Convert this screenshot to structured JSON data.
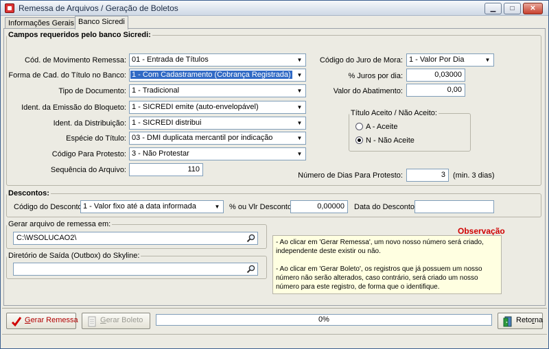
{
  "window": {
    "title": "Remessa de Arquivos / Geração de Boletos",
    "minimize_glyph": "▁",
    "maximize_glyph": "□",
    "close_glyph": "✕"
  },
  "tabs": [
    {
      "label": "Informações Gerais"
    },
    {
      "label": "Banco Sicredi"
    }
  ],
  "sicredi": {
    "legend": "Campos requeridos pelo banco Sicredi:",
    "cod_mov": {
      "label": "Cód. de Movimento Remessa:",
      "value": "01 - Entrada de Títulos"
    },
    "forma_cad": {
      "label": "Forma de Cad. do Título no Banco:",
      "value": "1 - Com Cadastramento (Cobrança Registrada)"
    },
    "tipo_doc": {
      "label": "Tipo de Documento:",
      "value": "1 - Tradicional"
    },
    "ident_emissao": {
      "label": "Ident. da Emissão do Bloqueto:",
      "value": "1 - SICREDI emite (auto-envelopável)"
    },
    "ident_distrib": {
      "label": "Ident. da Distribuição:",
      "value": "1 - SICREDI distribui"
    },
    "especie": {
      "label": "Espécie do Título:",
      "value": "03 - DMI duplicata mercantil por indicação"
    },
    "cod_protesto": {
      "label": "Código Para Protesto:",
      "value": "3 - Não Protestar"
    },
    "sequencia": {
      "label": "Sequência do Arquivo:",
      "value": "110"
    },
    "cod_juro": {
      "label": "Código do Juro de Mora:",
      "value": "1 - Valor Por Dia"
    },
    "juros_dia": {
      "label": "% Juros por dia:",
      "value": "0,03000"
    },
    "valor_abat": {
      "label": "Valor do Abatimento:",
      "value": "0,00"
    },
    "aceite": {
      "legend": "Título Aceito / Não Aceito:",
      "option_a": "A - Aceite",
      "option_n": "N - Não Aceite"
    },
    "dias_protesto": {
      "label": "Número de Dias Para Protesto:",
      "value": "3",
      "hint": "(min. 3 dias)"
    }
  },
  "descontos": {
    "legend": "Descontos:",
    "codigo": {
      "label": "Código do Desconto:",
      "value": "1 - Valor fixo até a data informada"
    },
    "perc": {
      "label": "% ou Vlr Desconto:",
      "value": "0,00000"
    },
    "data": {
      "label": "Data do Desconto:",
      "value": ""
    }
  },
  "remessa_path": {
    "legend": "Gerar arquivo de remessa em:",
    "value": "C:\\WSOLUCAO2\\"
  },
  "outbox_path": {
    "legend": "Diretório de Saída (Outbox) do Skyline:",
    "value": ""
  },
  "observacao": {
    "title": "Observação",
    "p1": "- Ao clicar em 'Gerar Remessa', um novo nosso número será criado, independente deste existir ou não.",
    "p2": "- Ao clicar em 'Gerar Boleto', os registros que já possuem um nosso número não serão alterados, caso contrário, será criado um nosso número para este registro, de forma que o identifique."
  },
  "buttons": {
    "gerar_remessa": {
      "u": "G",
      "rest": "erar Remessa"
    },
    "gerar_boleto": {
      "u": "G",
      "rest": "erar Boleto"
    },
    "retorna": {
      "pre": "Reto",
      "u": "r",
      "rest": "na"
    }
  },
  "progress": {
    "label": "0%",
    "value": 0
  },
  "colors": {
    "accent": "#316ac5",
    "obs_title": "#d00000",
    "obs_bg": "#ffffe1"
  }
}
